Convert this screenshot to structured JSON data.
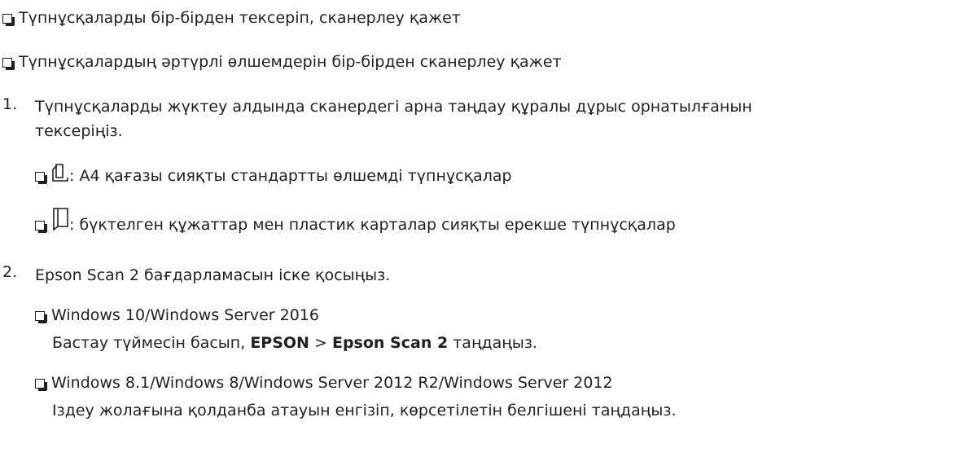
{
  "bullets_top": [
    "Түпнұсқаларды бір-бірден тексеріп, сканерлеу қажет",
    "Түпнұсқалардың әртүрлі өлшемдерін бір-бірден сканерлеу қажет"
  ],
  "step1": {
    "number": "1.",
    "line1": "Түпнұсқаларды жүктеу алдында сканердегі арна таңдау құралы дұрыс орнатылғанын",
    "line2": "тексеріңіз.",
    "options": [
      {
        "icon": "standard-paper-icon",
        "text": ": A4 қағазы сияқты стандартты өлшемді түпнұсқалар"
      },
      {
        "icon": "folded-paper-icon",
        "text": ": бүктелген құжаттар мен пластик карталар сияқты ерекше түпнұсқалар"
      }
    ]
  },
  "step2": {
    "number": "2.",
    "text": "Epson Scan 2 бағдарламасын іске қосыңыз.",
    "os1": {
      "title": "Windows 10/Windows Server 2016",
      "pre": "Бастау түймесін басып, ",
      "bold1": "EPSON",
      "sep": " > ",
      "bold2": "Epson Scan 2",
      "post": " таңдаңыз."
    },
    "os2": {
      "title": "Windows 8.1/Windows 8/Windows Server 2012 R2/Windows Server 2012",
      "text": "Іздеу жолағына қолданба атауын енгізіп, көрсетілетін белгішені таңдаңыз."
    }
  }
}
